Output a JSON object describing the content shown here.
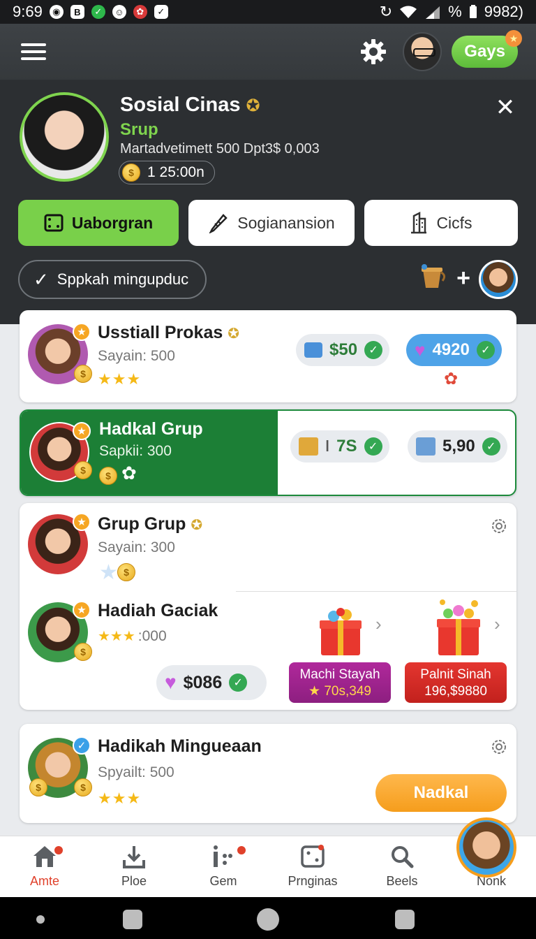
{
  "status_bar": {
    "time": "9:69",
    "battery_text": "9982)",
    "percent": "%"
  },
  "header": {
    "pill_label": "Gays"
  },
  "profile": {
    "name": "Sosial Cinas",
    "group": "Srup",
    "stats": "Martadvetimett 500  Dpt3$ 0,003",
    "coins": "1 25:00n"
  },
  "tabs": [
    {
      "label": "Uaborgran",
      "icon": "board-icon",
      "active": true
    },
    {
      "label": "Sogianansion",
      "icon": "pen-icon",
      "active": false
    },
    {
      "label": "Cicfs",
      "icon": "building-icon",
      "active": false
    }
  ],
  "filter": {
    "label": "Sppkah mingupduc"
  },
  "cards": [
    {
      "title": "Usstiall Prokas",
      "sub": "Sayain: 500",
      "stars": "★★★",
      "pills": [
        {
          "value": "$50"
        },
        {
          "value": "4920"
        }
      ]
    },
    {
      "title": "Hadkal Grup",
      "sub": "Sapkii: 300",
      "pills": [
        {
          "value": "7S"
        },
        {
          "value": "5,90"
        }
      ]
    },
    {
      "title": "Grup Grup",
      "sub": "Sayain: 300"
    },
    {
      "title": "Hadiah Gaciak",
      "sub": ":000",
      "stars": "★★★",
      "pill": "$086",
      "buttons": [
        {
          "line1": "Machi Stayah",
          "line2": "★ 70s,349"
        },
        {
          "line1": "Palnit Sinah",
          "line2": "196,$9880"
        }
      ]
    },
    {
      "title": "Hadikah Mingueaan",
      "sub": "Spyailt: 500",
      "stars": "★★★",
      "button": "Nadkal"
    }
  ],
  "bottom_nav": [
    {
      "label": "Amte",
      "icon": "home-icon",
      "active": true
    },
    {
      "label": "Ploe",
      "icon": "download-icon",
      "active": false
    },
    {
      "label": "Gem",
      "icon": "gem-icon",
      "active": false
    },
    {
      "label": "Prnginas",
      "icon": "dice-icon",
      "active": false
    },
    {
      "label": "Beels",
      "icon": "search-icon",
      "active": false
    },
    {
      "label": "Nonk",
      "icon": "avatar",
      "active": false
    }
  ]
}
